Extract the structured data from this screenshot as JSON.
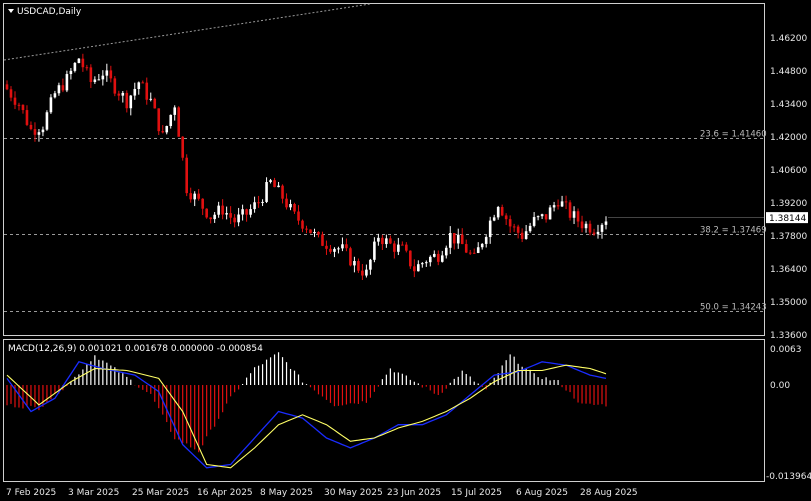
{
  "window": {
    "symbol_title": "USDCAD,Daily",
    "menu_icon": "triangle-down-icon"
  },
  "main_panel": {
    "price_axis": [
      "1.46200",
      "1.44800",
      "1.43400",
      "1.42000",
      "1.40600",
      "1.39200",
      "1.37800",
      "1.36400",
      "1.35000",
      "1.33600"
    ],
    "current_price": "1.38144",
    "fib_levels": [
      {
        "label": "23.6 = 1.41460",
        "value": 1.4146
      },
      {
        "label": "38.2 = 1.37469",
        "value": 1.37469
      },
      {
        "label": "50.0 = 1.34243",
        "value": 1.34243
      }
    ]
  },
  "indicator_panel": {
    "title": "MACD(12,26,9) 0.001021 0.001678 0.000000 -0.000854",
    "axis": [
      "0.0063",
      "0.00",
      "-0.013964"
    ]
  },
  "time_axis": [
    "7 Feb 2025",
    "3 Mar 2025",
    "25 Mar 2025",
    "16 Apr 2025",
    "8 May 2025",
    "30 May 2025",
    "23 Jun 2025",
    "15 Jul 2025",
    "6 Aug 2025",
    "28 Aug 2025"
  ],
  "colors": {
    "bull": "#ffffff",
    "bear": "#e01010",
    "macd_line": "#1a2cff",
    "signal_line": "#ffff66",
    "grid_dash": "#9a9a9a",
    "background": "#000000"
  },
  "chart_data": {
    "type": "candlestick",
    "title": "USDCAD,Daily",
    "ylim": [
      1.3325,
      1.4705
    ],
    "x": [
      "7 Feb 2025",
      "3 Mar 2025",
      "25 Mar 2025",
      "16 Apr 2025",
      "8 May 2025",
      "30 May 2025",
      "23 Jun 2025",
      "15 Jul 2025",
      "6 Aug 2025",
      "28 Aug 2025"
    ],
    "close_path": [
      [
        0,
        1.435
      ],
      [
        3,
        1.429
      ],
      [
        6,
        1.418
      ],
      [
        9,
        1.42
      ],
      [
        12,
        1.433
      ],
      [
        15,
        1.439
      ],
      [
        18,
        1.448
      ],
      [
        21,
        1.438
      ],
      [
        24,
        1.442
      ],
      [
        27,
        1.436
      ],
      [
        30,
        1.43
      ],
      [
        33,
        1.438
      ],
      [
        36,
        1.43
      ],
      [
        39,
        1.415
      ],
      [
        42,
        1.429
      ],
      [
        45,
        1.394
      ],
      [
        48,
        1.388
      ],
      [
        51,
        1.382
      ],
      [
        54,
        1.385
      ],
      [
        57,
        1.38
      ],
      [
        60,
        1.383
      ],
      [
        63,
        1.388
      ],
      [
        66,
        1.396
      ],
      [
        69,
        1.39
      ],
      [
        72,
        1.382
      ],
      [
        75,
        1.378
      ],
      [
        78,
        1.372
      ],
      [
        81,
        1.37
      ],
      [
        84,
        1.368
      ],
      [
        87,
        1.362
      ],
      [
        90,
        1.358
      ],
      [
        93,
        1.374
      ],
      [
        96,
        1.37
      ],
      [
        99,
        1.368
      ],
      [
        102,
        1.36
      ],
      [
        105,
        1.364
      ],
      [
        108,
        1.366
      ],
      [
        111,
        1.374
      ],
      [
        114,
        1.37
      ],
      [
        117,
        1.364
      ],
      [
        120,
        1.376
      ],
      [
        123,
        1.388
      ],
      [
        126,
        1.378
      ],
      [
        129,
        1.374
      ],
      [
        132,
        1.38
      ],
      [
        135,
        1.382
      ],
      [
        138,
        1.389
      ],
      [
        141,
        1.383
      ],
      [
        144,
        1.379
      ],
      [
        147,
        1.377
      ],
      [
        150,
        1.3814
      ]
    ],
    "macd": {
      "ylim": [
        -0.0145,
        0.0068
      ],
      "histogram_path": [
        [
          0,
          -0.003
        ],
        [
          8,
          -0.0035
        ],
        [
          16,
          0.0005
        ],
        [
          22,
          0.0045
        ],
        [
          28,
          0.002
        ],
        [
          36,
          -0.0015
        ],
        [
          42,
          -0.008
        ],
        [
          48,
          -0.01
        ],
        [
          56,
          -0.002
        ],
        [
          62,
          0.0025
        ],
        [
          68,
          0.0048
        ],
        [
          74,
          0.0006
        ],
        [
          82,
          -0.003
        ],
        [
          90,
          -0.0025
        ],
        [
          96,
          0.0025
        ],
        [
          102,
          0.0005
        ],
        [
          108,
          -0.0015
        ],
        [
          114,
          0.002
        ],
        [
          120,
          -0.0008
        ],
        [
          126,
          0.0045
        ],
        [
          132,
          0.0015
        ],
        [
          138,
          0.0005
        ],
        [
          144,
          -0.003
        ],
        [
          150,
          -0.003
        ]
      ],
      "macd_line_path": [
        [
          0,
          0.001
        ],
        [
          6,
          -0.004
        ],
        [
          12,
          -0.002
        ],
        [
          18,
          0.0035
        ],
        [
          24,
          0.0025
        ],
        [
          32,
          0.0015
        ],
        [
          38,
          -0.001
        ],
        [
          44,
          -0.009
        ],
        [
          50,
          -0.0125
        ],
        [
          56,
          -0.012
        ],
        [
          62,
          -0.008
        ],
        [
          68,
          -0.004
        ],
        [
          74,
          -0.005
        ],
        [
          80,
          -0.008
        ],
        [
          86,
          -0.0095
        ],
        [
          92,
          -0.008
        ],
        [
          98,
          -0.006
        ],
        [
          104,
          -0.006
        ],
        [
          110,
          -0.0045
        ],
        [
          116,
          -0.0015
        ],
        [
          122,
          0.0015
        ],
        [
          128,
          0.002
        ],
        [
          134,
          0.0035
        ],
        [
          140,
          0.003
        ],
        [
          146,
          0.0015
        ],
        [
          150,
          0.001
        ]
      ],
      "signal_line_path": [
        [
          0,
          0.0015
        ],
        [
          8,
          -0.003
        ],
        [
          16,
          0.0005
        ],
        [
          22,
          0.0025
        ],
        [
          30,
          0.0022
        ],
        [
          38,
          0.001
        ],
        [
          44,
          -0.004
        ],
        [
          50,
          -0.012
        ],
        [
          56,
          -0.0125
        ],
        [
          62,
          -0.0095
        ],
        [
          68,
          -0.006
        ],
        [
          74,
          -0.0045
        ],
        [
          80,
          -0.006
        ],
        [
          86,
          -0.0085
        ],
        [
          92,
          -0.008
        ],
        [
          98,
          -0.0065
        ],
        [
          104,
          -0.0055
        ],
        [
          110,
          -0.004
        ],
        [
          116,
          -0.002
        ],
        [
          122,
          0.0005
        ],
        [
          128,
          0.0022
        ],
        [
          134,
          0.0022
        ],
        [
          140,
          0.003
        ],
        [
          146,
          0.0025
        ],
        [
          150,
          0.0017
        ]
      ]
    }
  }
}
